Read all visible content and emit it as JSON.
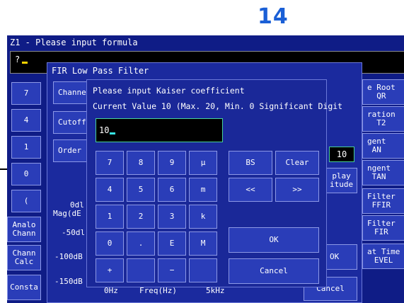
{
  "page_number": "14",
  "screen": {
    "title": "Z1 - Please input formula",
    "formula_prompt": "?"
  },
  "left_keys": [
    "7",
    "4",
    "1",
    "0",
    "(",
    "Analo\nChann",
    "Chann\nCalc",
    "Consta"
  ],
  "right_keys": [
    "e Root\nQR",
    "ration\nT2",
    "gent\nAN",
    "ngent\nTAN",
    "Filter\nFFIR",
    "Filter\nFIR",
    "at Time\nEVEL"
  ],
  "fir_window": {
    "title": "FIR Low Pass Filter",
    "buttons": [
      "Channe",
      "Cutoff",
      "Order"
    ],
    "order_value": "10",
    "display_button": "play\nitude",
    "ok_button": "OK",
    "cancel_button": "Cancel",
    "graph": {
      "ylabel_top": "0dl",
      "ylabel": "Mag(dE",
      "yticks": [
        "-50dl",
        "-100dB",
        "-150dB"
      ],
      "xticks": [
        "0Hz",
        "Freq(Hz)",
        "5kHz"
      ]
    }
  },
  "kaiser_dialog": {
    "line1": "Please input Kaiser coefficient",
    "line2": "Current Value 10 (Max. 20, Min. 0 Significant Digit",
    "input_value": "10",
    "keys": [
      [
        "7",
        "8",
        "9",
        "μ"
      ],
      [
        "4",
        "5",
        "6",
        "m"
      ],
      [
        "1",
        "2",
        "3",
        "k"
      ],
      [
        "0",
        ".",
        "E",
        "M"
      ],
      [
        "+",
        "",
        "−",
        ""
      ]
    ],
    "bs": "BS",
    "clear": "Clear",
    "back": "<<",
    "forward": ">>",
    "ok": "OK",
    "cancel": "Cancel"
  }
}
